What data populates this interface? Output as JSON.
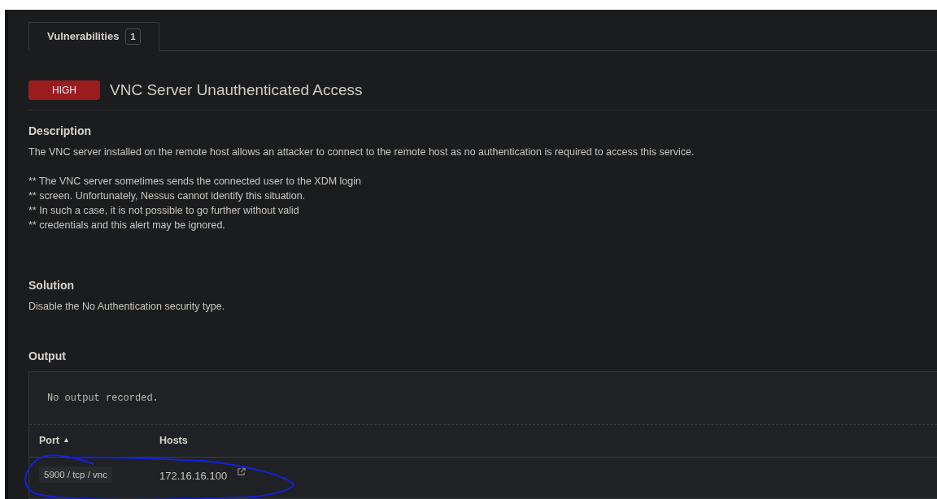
{
  "tabs": [
    {
      "label": "Vulnerabilities",
      "count": "1",
      "selected": true
    }
  ],
  "vulnerability": {
    "severity": "HIGH",
    "color": "#9b1c1f",
    "title": "VNC Server Unauthenticated Access"
  },
  "description": {
    "heading": "Description",
    "paragraphs": [
      "The VNC server installed on the remote host allows an attacker to connect to the remote host as no authentication is required to access this service.",
      "** The VNC server sometimes sends the connected user to the XDM login\n** screen. Unfortunately, Nessus cannot identify this situation.\n** In such a case, it is not possible to go further without valid\n** credentials and this alert may be ignored."
    ]
  },
  "solution": {
    "heading": "Solution",
    "text": "Disable the No Authentication security type."
  },
  "output": {
    "heading": "Output",
    "text": "No output recorded.",
    "columns": [
      {
        "label": "Port",
        "sort": "▲"
      },
      {
        "label": "Hosts"
      }
    ],
    "rows": [
      {
        "port": "5900 / tcp / vnc",
        "host": "172.16.16.100"
      }
    ]
  }
}
